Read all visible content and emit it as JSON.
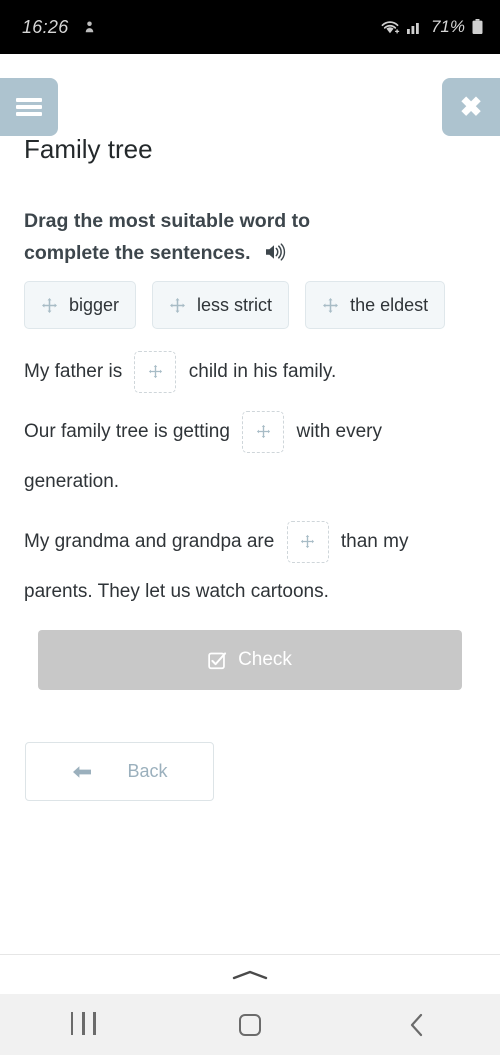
{
  "status_bar": {
    "time": "16:26",
    "notification_icon": "app-notification-icon",
    "wifi_icon": "wifi-icon",
    "signal_icon": "cellular-signal-icon",
    "battery_percent": "71%",
    "battery_icon": "battery-icon"
  },
  "header": {
    "menu_icon": "hamburger-menu-icon",
    "close_icon": "close-icon",
    "button_color": "#adc3cf"
  },
  "page": {
    "title": "Family tree"
  },
  "instruction": {
    "line1": "Drag the most suitable word to",
    "line2": "complete the sentences.",
    "audio_icon": "speaker-audio-icon"
  },
  "word_bank": {
    "drag_icon": "move-arrows-icon",
    "chips": [
      {
        "label": "bigger"
      },
      {
        "label": "less strict"
      },
      {
        "label": "the eldest"
      }
    ]
  },
  "sentences": {
    "dropzone_icon": "move-arrows-icon",
    "items": [
      {
        "before": "My father is",
        "after": "child in his family."
      },
      {
        "before": "Our family tree is getting",
        "after": "with every generation."
      },
      {
        "before": "My grandma and grandpa are",
        "after": "than my parents. They let us watch cartoons."
      }
    ]
  },
  "actions": {
    "check_label": "Check",
    "check_icon": "checkbox-checked-icon",
    "check_enabled": false,
    "check_color": "#c8c8c8",
    "back_label": "Back",
    "back_icon": "arrow-left-icon"
  },
  "system_nav": {
    "drag_handle_icon": "chevron-up-icon",
    "recents_icon": "recents-icon",
    "home_icon": "home-icon",
    "back_icon": "nav-back-chevron-icon"
  }
}
